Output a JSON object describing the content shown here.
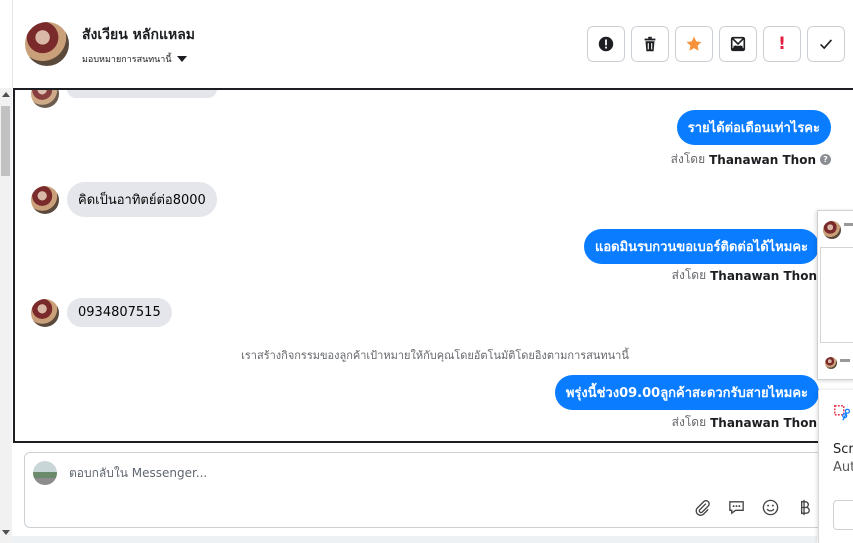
{
  "header": {
    "contact_name": "สังเวียน หลักแหลม",
    "assign_label": "มอบหมายการสนทนานี้",
    "actions": [
      {
        "name": "spam-alert-button",
        "icon": "alert-circle-icon"
      },
      {
        "name": "delete-button",
        "icon": "trash-icon"
      },
      {
        "name": "star-button",
        "icon": "star-icon"
      },
      {
        "name": "mark-unread-button",
        "icon": "envelope-icon"
      },
      {
        "name": "follow-up-button",
        "icon": "exclamation-icon",
        "label": "!"
      },
      {
        "name": "mark-done-button",
        "icon": "check-icon"
      }
    ]
  },
  "conversation": {
    "messages": [
      {
        "type": "out",
        "text": "รายได้ต่อเดือนเท่าไรคะ"
      },
      {
        "type": "sent_by",
        "prefix": "ส่งโดย",
        "name": "Thanawan Thon"
      },
      {
        "type": "in",
        "text": "คิดเป็นอาทิตย์ต่อ8000"
      },
      {
        "type": "out",
        "text": "แอดมินรบกวนขอเบอร์ติดต่อได้ไหมคะ"
      },
      {
        "type": "sent_by",
        "prefix": "ส่งโดย",
        "name": "Thanawan Thon"
      },
      {
        "type": "in",
        "text": "0934807515"
      },
      {
        "type": "system",
        "text": "เราสร้างกิจกรรมของลูกค้าเป้าหมายให้กับคุณโดยอัตโนมัติโดยอิงตามการสนทนานี้"
      },
      {
        "type": "out",
        "text": "พรุ่งนี้ช่วง09.00ลูกค้าสะดวกรับสายไหมคะ"
      },
      {
        "type": "sent_by",
        "prefix": "ส่งโดย",
        "name": "Thanawan Thon"
      }
    ]
  },
  "composer": {
    "placeholder": "ตอบกลับใน Messenger..."
  },
  "overlay": {
    "text_line_1": "Scre",
    "text_line_2": "Aut"
  },
  "colors": {
    "accent": "#0a7cff",
    "incoming_bubble": "#e4e6eb",
    "star": "#f7923a",
    "alert_red": "#e41e3f"
  }
}
